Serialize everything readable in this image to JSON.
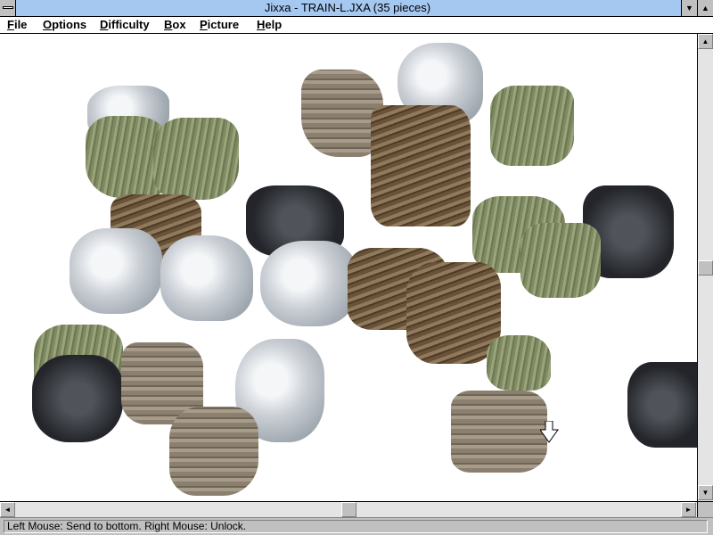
{
  "window": {
    "title": "Jixxa - TRAIN-L.JXA (35 pieces)"
  },
  "titlebar_buttons": {
    "system_menu": "system-menu-icon",
    "minimize_glyph": "▼",
    "maximize_glyph": "▲"
  },
  "menu": {
    "items": [
      "File",
      "Options",
      "Difficulty",
      "Box",
      "Picture",
      "Help"
    ]
  },
  "puzzle": {
    "piece_count": 35,
    "image_name": "TRAIN-L.JXA"
  },
  "scrollbars": {
    "up_glyph": "▲",
    "down_glyph": "▼",
    "left_glyph": "◄",
    "right_glyph": "►"
  },
  "status": {
    "text": "Left Mouse: Send to bottom. Right Mouse: Unlock."
  },
  "colors": {
    "title_bar": "#a4c8f0",
    "client_background": "#ffffff",
    "chrome": "#c0c0c0"
  }
}
